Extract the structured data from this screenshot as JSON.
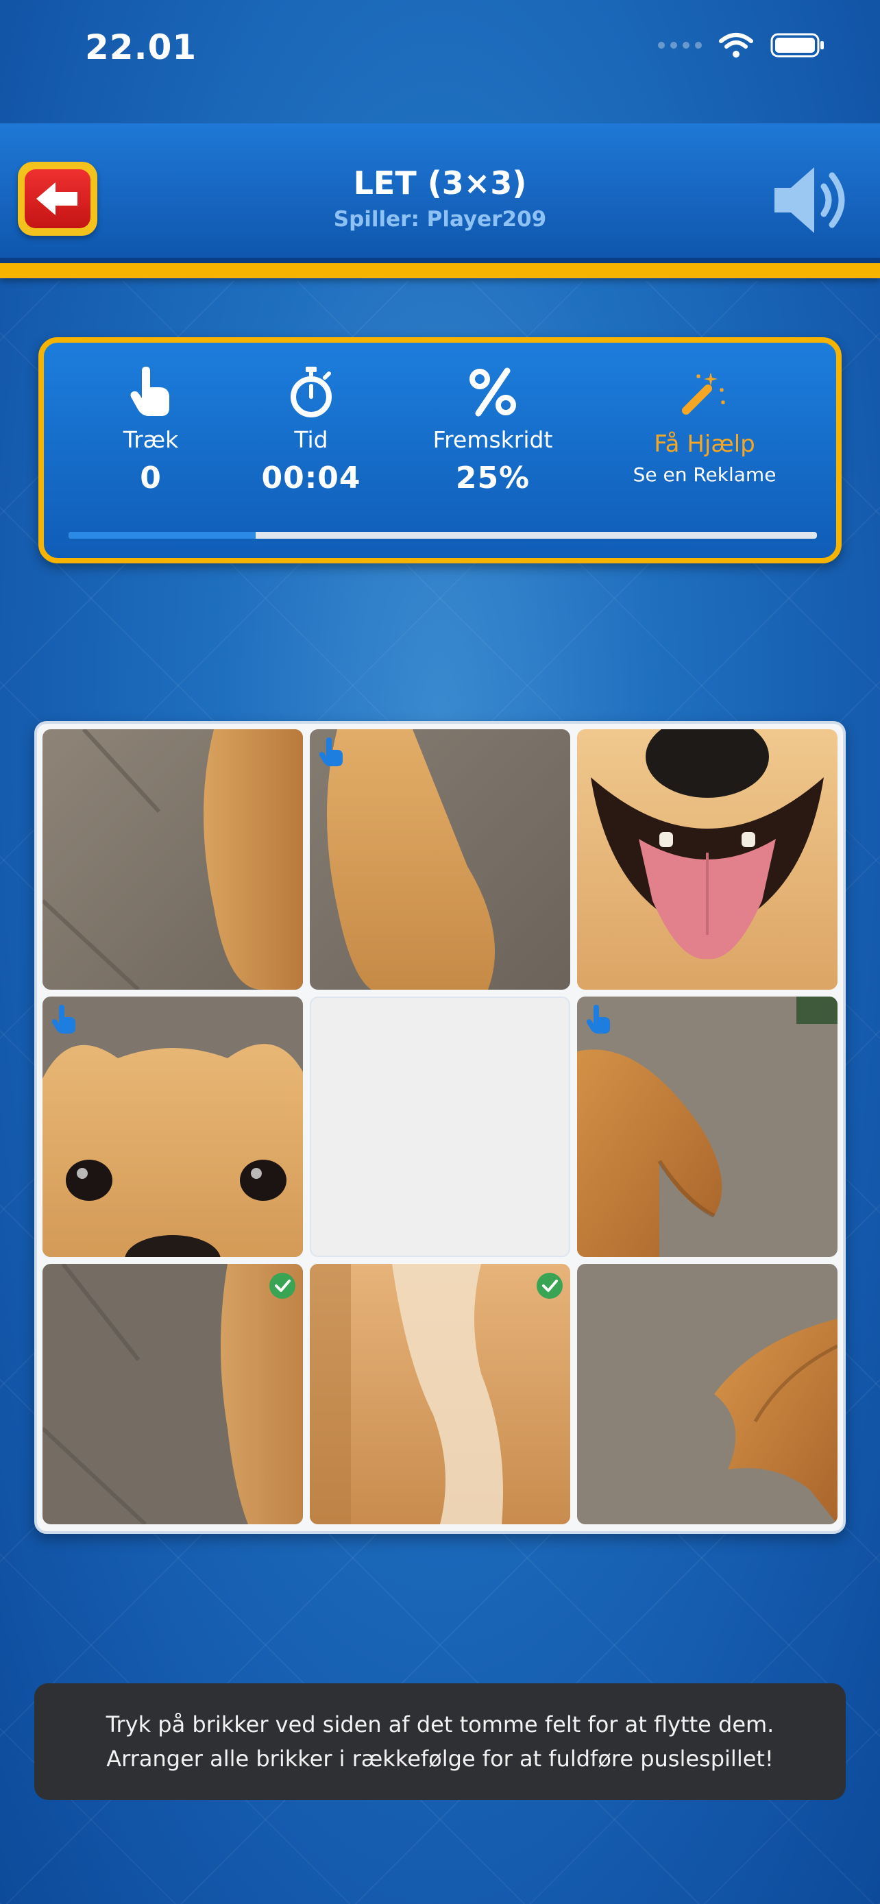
{
  "status_bar": {
    "time": "22.01"
  },
  "header": {
    "title": "LET (3×3)",
    "player_label": "Spiller: Player209"
  },
  "stats": {
    "moves": {
      "label": "Træk",
      "value": "0",
      "icon": "pointer-hand-icon"
    },
    "time": {
      "label": "Tid",
      "value": "00:04",
      "icon": "stopwatch-icon"
    },
    "progress": {
      "label": "Fremskridt",
      "value": "25%",
      "icon": "percent-icon"
    },
    "help": {
      "label": "Få Hjælp",
      "sub": "Se en Reklame",
      "icon": "magic-wand-icon"
    },
    "progress_fraction": 0.25
  },
  "board": {
    "tiles": [
      {
        "piece": "leg-left",
        "status": "none"
      },
      {
        "piece": "chest-top",
        "status": "movable"
      },
      {
        "piece": "mouth",
        "status": "none"
      },
      {
        "piece": "eyes",
        "status": "movable"
      },
      {
        "piece": "empty",
        "status": "empty"
      },
      {
        "piece": "ear-right",
        "status": "movable"
      },
      {
        "piece": "leg-bottom-left",
        "status": "correct"
      },
      {
        "piece": "chest-bottom",
        "status": "correct"
      },
      {
        "piece": "ear-bottom-right",
        "status": "none"
      }
    ]
  },
  "hint": {
    "line1": "Tryk på brikker ved siden af det tomme felt for at flytte dem.",
    "line2": "Arranger alle brikker i rækkefølge for at fuldføre puslespillet!"
  },
  "colors": {
    "accent": "#f6b400",
    "primary": "#1569c2",
    "correct": "#3aa455",
    "movable": "#1e7ee0"
  }
}
